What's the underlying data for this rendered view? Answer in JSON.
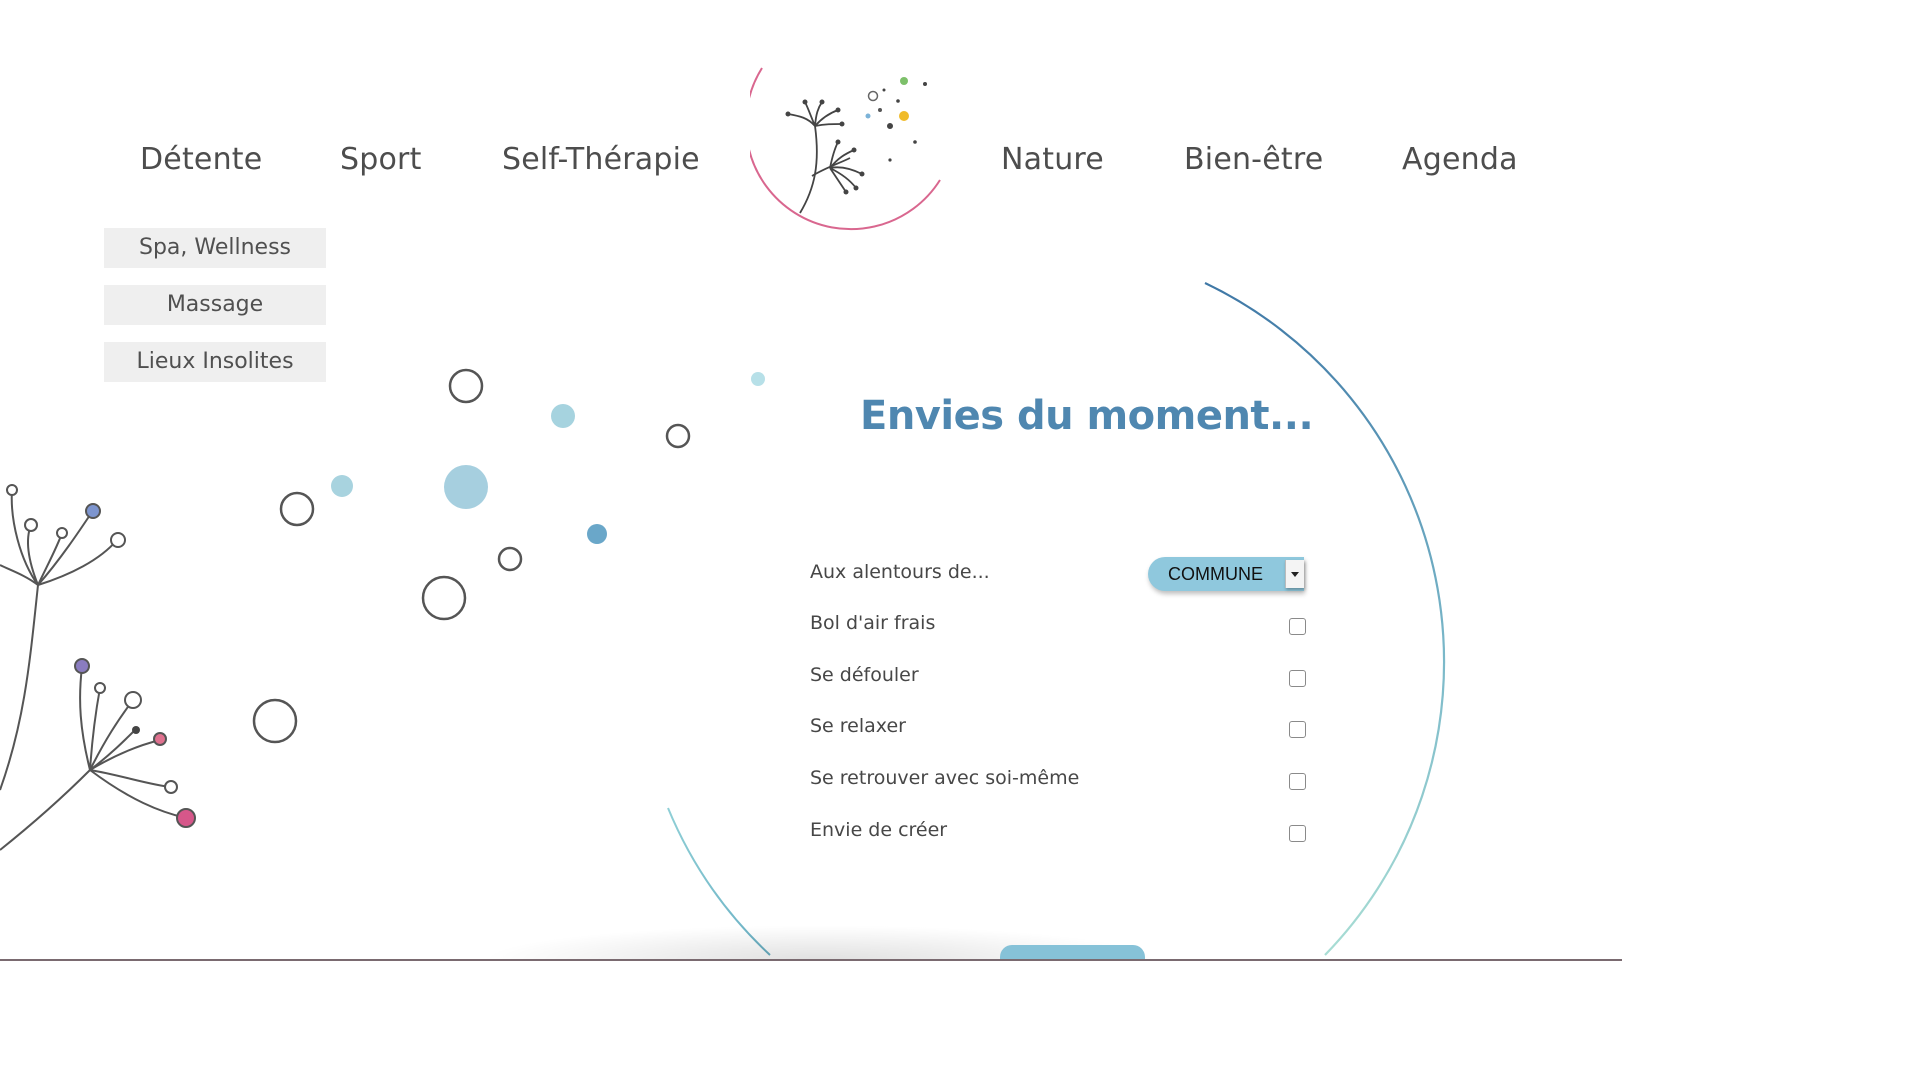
{
  "nav": {
    "left": [
      "Détente",
      "Sport",
      "Self-Thérapie"
    ],
    "right": [
      "Nature",
      "Bien-être",
      "Agenda"
    ]
  },
  "submenu": [
    "Spa, Wellness",
    "Massage",
    "Lieux Insolites"
  ],
  "logo": {
    "icon": "dandelion-logo-icon"
  },
  "main": {
    "title": "Envies du moment...",
    "location_label": "Aux alentours de...",
    "location_select": "COMMUNE",
    "options": [
      {
        "label": "Bol d'air frais",
        "checked": false
      },
      {
        "label": "Se défouler",
        "checked": false
      },
      {
        "label": "Se relaxer",
        "checked": false
      },
      {
        "label": "Se retrouver avec soi-même",
        "checked": false
      },
      {
        "label": "Envie de créer",
        "checked": false
      }
    ]
  },
  "colors": {
    "title": "#4f87b0",
    "select_bg": "#8fc8dd",
    "accent_pink": "#d9678f",
    "accent_blue": "#6aa7c9"
  }
}
